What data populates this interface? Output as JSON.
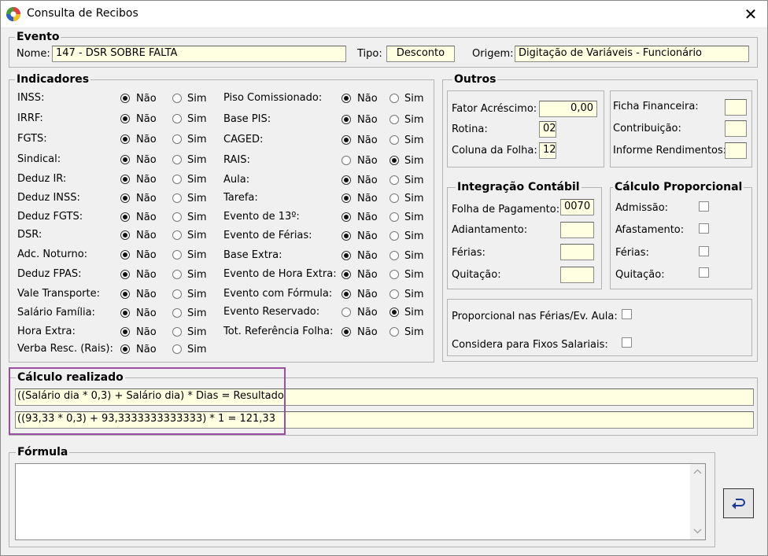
{
  "window": {
    "title": "Consulta de Recibos",
    "close_glyph": "✕"
  },
  "evento": {
    "legend": "Evento",
    "nome_label": "Nome:",
    "nome_value": "147 - DSR SOBRE FALTA",
    "tipo_label": "Tipo:",
    "tipo_value": "Desconto",
    "origem_label": "Origem:",
    "origem_value": "Digitação de Variáveis - Funcionário"
  },
  "indicadores": {
    "legend": "Indicadores",
    "nao": "Não",
    "sim": "Sim",
    "col1": [
      {
        "label": "INSS:",
        "selected": "nao"
      },
      {
        "label": "IRRF:",
        "selected": "nao"
      },
      {
        "label": "FGTS:",
        "selected": "nao"
      },
      {
        "label": "Sindical:",
        "selected": "nao"
      },
      {
        "label": "Deduz IR:",
        "selected": "nao"
      },
      {
        "label": "Deduz INSS:",
        "selected": "nao"
      },
      {
        "label": "Deduz FGTS:",
        "selected": "nao"
      },
      {
        "label": "DSR:",
        "selected": "nao"
      },
      {
        "label": "Adc. Noturno:",
        "selected": "nao"
      },
      {
        "label": "Deduz FPAS:",
        "selected": "nao"
      },
      {
        "label": "Vale Transporte:",
        "selected": "nao"
      },
      {
        "label": "Salário Família:",
        "selected": "nao"
      },
      {
        "label": "Hora Extra:",
        "selected": "nao"
      },
      {
        "label": "Verba Resc. (Rais):",
        "selected": "nao"
      }
    ],
    "col2": [
      {
        "label": "Piso Comissionado:",
        "selected": "nao"
      },
      {
        "label": "Base PIS:",
        "selected": "nao"
      },
      {
        "label": "CAGED:",
        "selected": "nao"
      },
      {
        "label": "RAIS:",
        "selected": "sim"
      },
      {
        "label": "Aula:",
        "selected": "nao"
      },
      {
        "label": "Tarefa:",
        "selected": "nao"
      },
      {
        "label": "Evento de 13º:",
        "selected": "nao"
      },
      {
        "label": "Evento de Férias:",
        "selected": "nao"
      },
      {
        "label": "Base Extra:",
        "selected": "nao"
      },
      {
        "label": "Evento de Hora Extra:",
        "selected": "nao"
      },
      {
        "label": "Evento com Fórmula:",
        "selected": "nao"
      },
      {
        "label": "Evento Reservado:",
        "selected": "sim"
      },
      {
        "label": "Tot. Referência Folha:",
        "selected": "nao"
      }
    ]
  },
  "outros": {
    "legend": "Outros",
    "fator_label": "Fator Acréscimo:",
    "fator_value": "0,00",
    "rotina_label": "Rotina:",
    "rotina_value": "02",
    "coluna_label": "Coluna da Folha:",
    "coluna_value": "12",
    "ficha_label": "Ficha Financeira:",
    "ficha_value": "",
    "contribuicao_label": "Contribuição:",
    "contribuicao_value": "",
    "informe_label": "Informe Rendimentos:",
    "informe_value": ""
  },
  "integracao": {
    "legend": "Integração Contábil",
    "folha_label": "Folha de Pagamento:",
    "folha_value": "0070",
    "adiantamento_label": "Adiantamento:",
    "adiantamento_value": "",
    "ferias_label": "Férias:",
    "ferias_value": "",
    "quitacao_label": "Quitação:",
    "quitacao_value": ""
  },
  "calculo_proporcional": {
    "legend": "Cálculo Proporcional",
    "admissao_label": "Admissão:",
    "afastamento_label": "Afastamento:",
    "ferias_label": "Férias:",
    "quitacao_label": "Quitação:"
  },
  "proporcional": {
    "ferias_aula_label": "Proporcional nas Férias/Ev. Aula:",
    "fixos_label": "Considera para Fixos Salariais:"
  },
  "calculo_realizado": {
    "legend": "Cálculo realizado",
    "formula_text": "((Salário dia * 0,3) + Salário dia) * Dias = Resultado",
    "values_text": "((93,33 * 0,3) + 93,3333333333333) * 1 = 121,33"
  },
  "formula": {
    "legend": "Fórmula",
    "value": ""
  },
  "colors": {
    "field_bg": "#ffffe1",
    "highlight": "#9b4f9f",
    "window_bg": "#f0f0f0"
  }
}
